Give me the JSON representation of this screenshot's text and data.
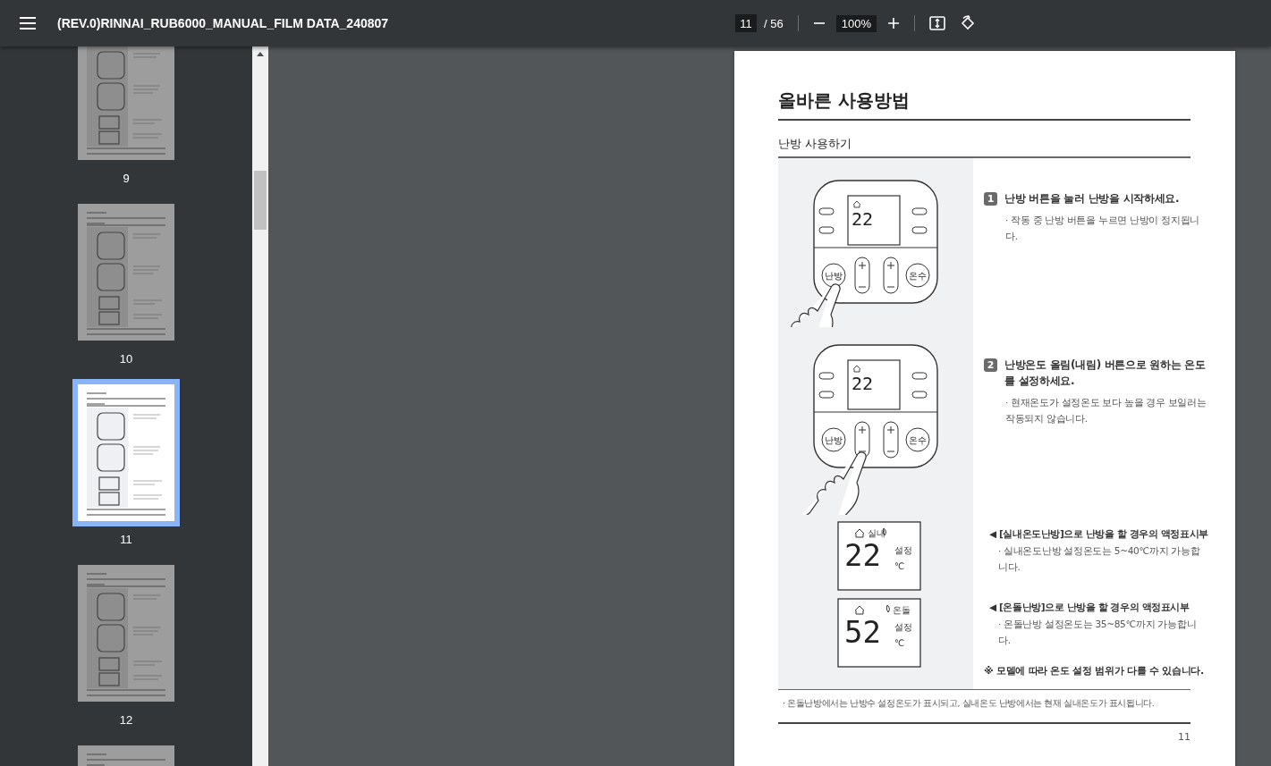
{
  "toolbar": {
    "title": "(REV.0)RINNAI_RUB6000_MANUAL_FILM DATA_240807",
    "page_input": {
      "value": "11"
    },
    "page_count": "/ 56",
    "zoom": "100%"
  },
  "thumbnails": [
    {
      "label": "9",
      "selected": false
    },
    {
      "label": "10",
      "selected": false
    },
    {
      "label": "11",
      "selected": true
    },
    {
      "label": "12",
      "selected": false
    },
    {
      "selected": false
    }
  ],
  "page": {
    "title": "올바른 사용방법",
    "section": "난방 사용하기",
    "steps": [
      {
        "number": "1",
        "heading": "난방 버튼을 눌러 난방을 시작하세요.",
        "note": "· 작동 중 난방 버튼을 누르면 난방이 정지됩니다.",
        "device": {
          "display": "22",
          "buttons": [
            "난방",
            "온수"
          ],
          "kind": "heat"
        }
      },
      {
        "number": "2",
        "heading": "난방온도 올림(내림) 버튼으로 원하는 온도를 설정하세요.",
        "note": "· 현재온도가 설정온도 보다 높을 경우 보일러는 작동되지 않습니다.",
        "device": {
          "display": "22",
          "buttons": [
            "난방",
            "온수"
          ],
          "kind": "down"
        }
      }
    ],
    "lcd_notes": [
      {
        "display": "22",
        "kind": "indoor",
        "mode_label": "실내",
        "set_label": "설정",
        "unit": "℃",
        "heading": "◀ [실내온도난방]으로 난방을 할 경우의 액정표시부",
        "note": "· 실내온도난방 설정온도는 5~40℃까지 가능합니다."
      },
      {
        "display": "52",
        "kind": "ondol",
        "mode_label": "온돌",
        "set_label": "설정",
        "unit": "℃",
        "heading": "◀ [온돌난방]으로 난방을 할 경우의 액정표시부",
        "note": "· 온돌난방 설정온도는 35~85℃까지 가능합니다."
      }
    ],
    "remark": "※ 모델에 따라 온도 설정 범위가 다를 수 있습니다.",
    "footnote": "· 온돌난방에서는 난방수 설정온도가 표시되고, 실내온도 난방에서는 현재 실내온도가 표시됩니다.",
    "page_number": "11"
  }
}
